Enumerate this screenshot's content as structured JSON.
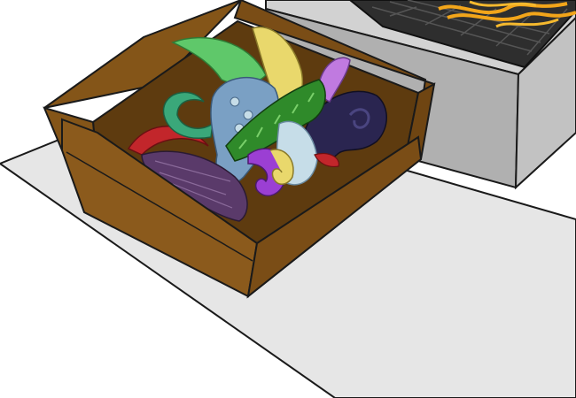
{
  "scene": {
    "description_items": [
      "floor-mat",
      "box-of-tentacles",
      "fryer"
    ],
    "colors": {
      "background": "#ffffff",
      "floor_mat": "#e6e6e6",
      "outline": "#1a1a1a",
      "box_front": "#8b5a1c",
      "box_side": "#7a4d16",
      "box_flap": "#845518",
      "box_inner": "#5e3b0f",
      "fryer_top": "#d2d2d2",
      "fryer_front": "#b0b0b0",
      "fryer_side": "#c2c2c2",
      "fryer_basket": "#333333",
      "fries": "#f2a51a",
      "tentacle_green": "#5fc86a",
      "tentacle_yellow": "#e9d86c",
      "tentacle_blue": "#7aa0c4",
      "tentacle_darkgreen": "#2f8a2a",
      "tentacle_teal": "#3aa87a",
      "tentacle_purple": "#9b3fd3",
      "tentacle_violet": "#c07ae0",
      "tentacle_navy": "#2a2550",
      "tentacle_red": "#c2262b",
      "tentacle_darkpurple": "#5a3a6a",
      "tentacle_paleblue": "#c6dde8"
    },
    "icons": [
      "box-icon",
      "fryer-icon",
      "tentacle-icon"
    ]
  }
}
